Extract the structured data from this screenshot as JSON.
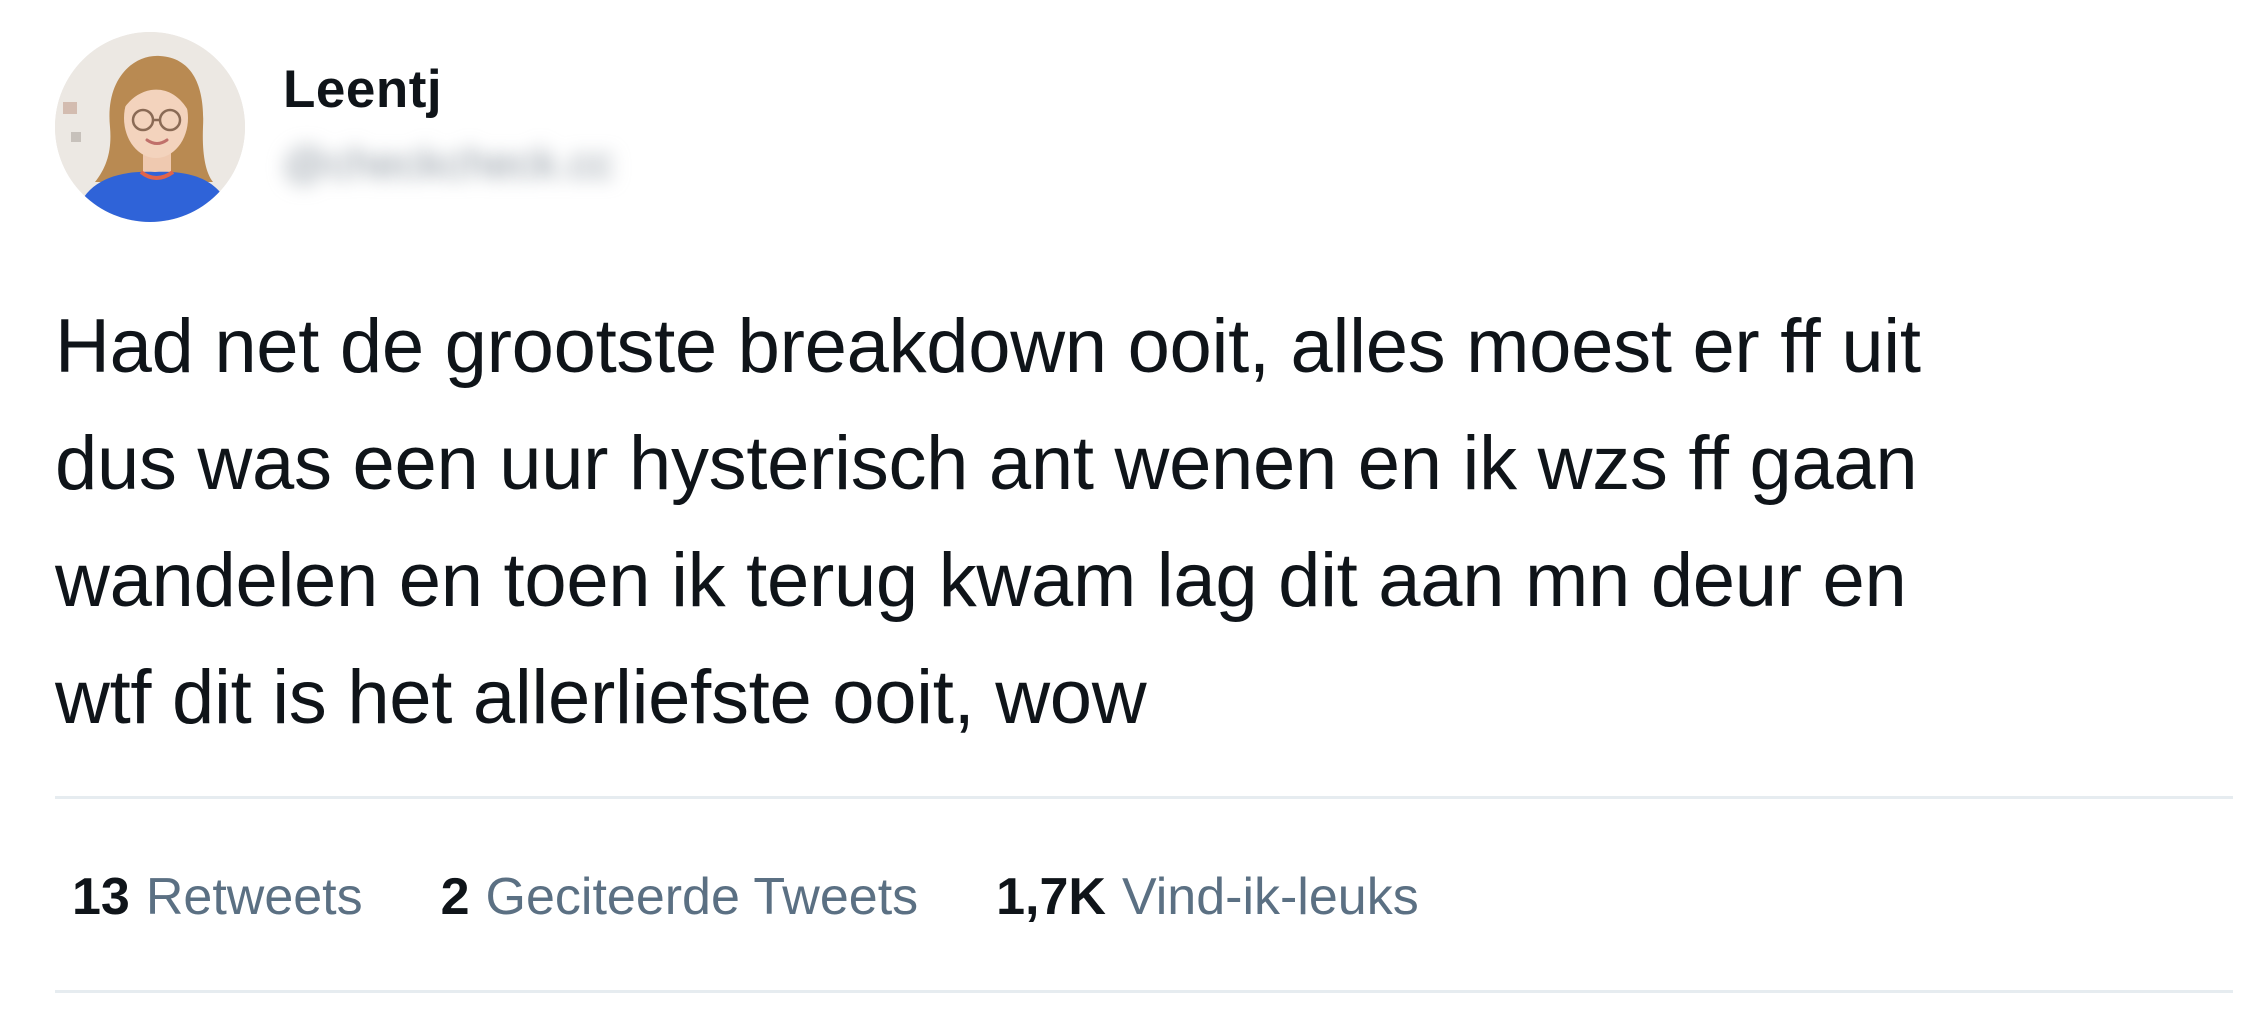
{
  "user": {
    "display_name": "Leentj",
    "handle": "@checkcheck.cc",
    "avatar_icon": "profile-photo"
  },
  "tweet": {
    "text": "Had net de grootste breakdown ooit, alles moest er ff uit\ndus was een uur hysterisch ant wenen en ik wzs ff gaan\nwandelen en toen ik terug kwam lag dit aan mn deur en\nwtf dit is het allerliefste ooit, wow"
  },
  "stats": {
    "retweets": {
      "count": "13",
      "label": "Retweets"
    },
    "quotes": {
      "count": "2",
      "label": "Geciteerde Tweets"
    },
    "likes": {
      "count": "1,7K",
      "label": "Vind-ik-leuks"
    }
  },
  "colors": {
    "text_primary": "#0f1419",
    "text_secondary": "#5b7083",
    "divider": "#e6ecf0"
  }
}
